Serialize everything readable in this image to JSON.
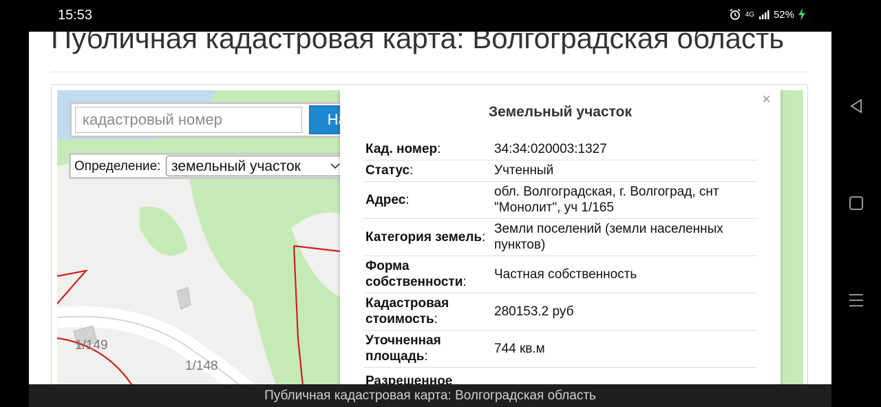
{
  "status_bar": {
    "time": "15:53",
    "network": "4G",
    "battery": "52%",
    "icons": [
      "alarm-icon",
      "signal-icon",
      "charging-icon"
    ]
  },
  "page": {
    "title": "Публичная кадастровая карта: Волгоградская область"
  },
  "search": {
    "placeholder": "кадастровый номер",
    "button": "Найти"
  },
  "definition": {
    "label": "Определение:",
    "selected": "земельный участок"
  },
  "map": {
    "plot_labels": [
      "1/149",
      "1/148"
    ]
  },
  "popup": {
    "close": "×",
    "title": "Земельный участок",
    "rows": [
      {
        "label": "Кад. номер",
        "value": "34:34:020003:1327"
      },
      {
        "label": "Статус",
        "value": "Учтенный"
      },
      {
        "label": "Адрес",
        "value": "обл. Волгоградская, г. Волгоград, снт \"Монолит\", уч 1/165"
      },
      {
        "label": "Категория земель",
        "value": "Земли поселений (земли населенных пунктов)"
      },
      {
        "label": "Форма собственности",
        "value": "Частная собственность"
      },
      {
        "label": "Кадастровая стоимость",
        "value": "280153.2 руб"
      },
      {
        "label": "Уточненная площадь",
        "value": "744 кв.м"
      },
      {
        "label": "Разрешенное",
        "value": ""
      }
    ]
  },
  "bottom_bar": {
    "title": "Публичная кадастровая карта: Волгоградская область"
  },
  "colors": {
    "button": "#1d87cf",
    "map_green": "#c6eab6",
    "plot_border": "#d11f1f"
  }
}
